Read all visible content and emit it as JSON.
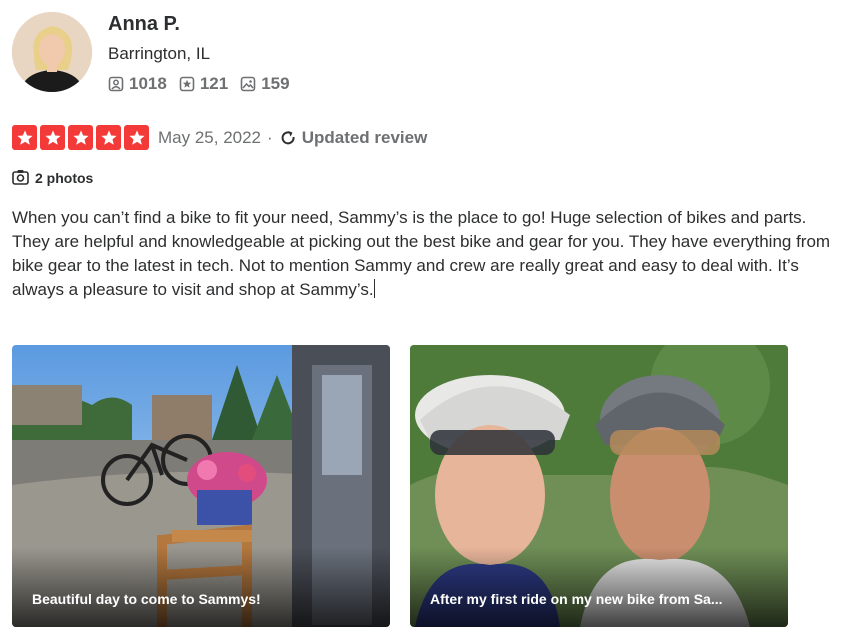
{
  "user": {
    "name": "Anna P.",
    "location": "Barrington, IL",
    "stats": {
      "friends": "1018",
      "reviews": "121",
      "photos": "159"
    }
  },
  "review": {
    "rating": 5,
    "date": "May 25, 2022",
    "separator": "·",
    "updated_label": "Updated review",
    "photos_label": "2 photos",
    "text": "When you can’t find a bike to fit your need, Sammy’s is the place to go! Huge selection of bikes and parts. They are helpful and knowledgeable at picking out the best bike and gear for you. They have everything from bike gear to the latest in tech. Not to mention Sammy and crew are really great and easy to deal with. It’s always a pleasure to visit and shop at Sammy’s."
  },
  "photos": [
    {
      "caption": "Beautiful day to come to Sammys!"
    },
    {
      "caption": "After my first ride on my new bike from Sa..."
    }
  ],
  "colors": {
    "star_red": "#f43939",
    "text_dark": "#2d2e2f",
    "text_gray": "#6e7072"
  },
  "icons": [
    "friends-icon",
    "reviews-icon",
    "photos-icon",
    "star-icon",
    "refresh-icon",
    "camera-icon"
  ]
}
